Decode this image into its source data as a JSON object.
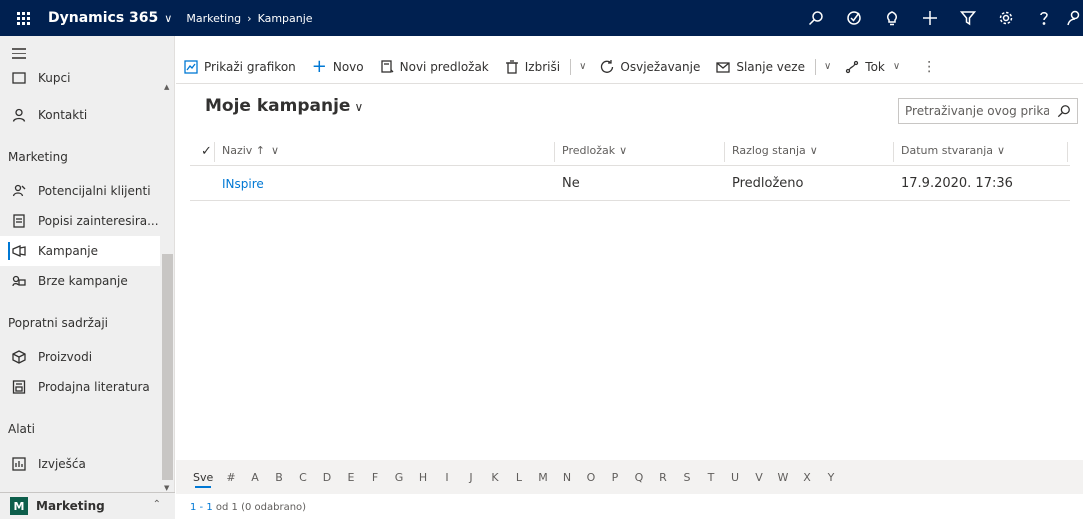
{
  "topbar": {
    "app_title": "Dynamics 365",
    "breadcrumb": [
      "Marketing",
      "Kampanje"
    ]
  },
  "sidebar": {
    "items_top": [
      {
        "label": "Kupci",
        "icon": "card-icon"
      },
      {
        "label": "Kontakti",
        "icon": "person-icon"
      }
    ],
    "group_marketing": "Marketing",
    "items_marketing": [
      {
        "label": "Potencijalni klijenti",
        "icon": "phone-person-icon"
      },
      {
        "label": "Popisi zainteresira...",
        "icon": "list-icon"
      },
      {
        "label": "Kampanje",
        "icon": "megaphone-icon",
        "active": true
      },
      {
        "label": "Brze kampanje",
        "icon": "quick-campaign-icon"
      }
    ],
    "group_related": "Popratni sadržaji",
    "items_related": [
      {
        "label": "Proizvodi",
        "icon": "box-icon"
      },
      {
        "label": "Prodajna literatura",
        "icon": "document-icon"
      }
    ],
    "group_tools": "Alati",
    "items_tools": [
      {
        "label": "Izvješća",
        "icon": "report-icon"
      }
    ],
    "area": {
      "badge": "M",
      "label": "Marketing"
    }
  },
  "commands": {
    "show_chart": "Prikaži grafikon",
    "new": "Novo",
    "new_template": "Novi predložak",
    "delete": "Izbriši",
    "refresh": "Osvježavanje",
    "send_link": "Slanje veze",
    "flow": "Tok"
  },
  "view": {
    "title": "Moje kampanje",
    "search_placeholder": "Pretraživanje ovog prikaza"
  },
  "grid": {
    "columns": [
      "Naziv ↑",
      "Predložak",
      "Razlog stanja",
      "Datum stvaranja"
    ],
    "rows": [
      {
        "name": "INspire",
        "template": "Ne",
        "status_reason": "Predloženo",
        "created": "17.9.2020. 17:36"
      }
    ]
  },
  "alphabet": [
    "Sve",
    "#",
    "A",
    "B",
    "C",
    "D",
    "E",
    "F",
    "G",
    "H",
    "I",
    "J",
    "K",
    "L",
    "M",
    "N",
    "O",
    "P",
    "Q",
    "R",
    "S",
    "T",
    "U",
    "V",
    "W",
    "X",
    "Y"
  ],
  "footer": {
    "range": "1 - 1",
    "rest": " od 1 (0 odabrano)"
  },
  "colors": {
    "topbar": "#002050",
    "accent": "#0078d4",
    "sidebar_bg": "#efefef",
    "area_badge": "#0d5e4b"
  }
}
